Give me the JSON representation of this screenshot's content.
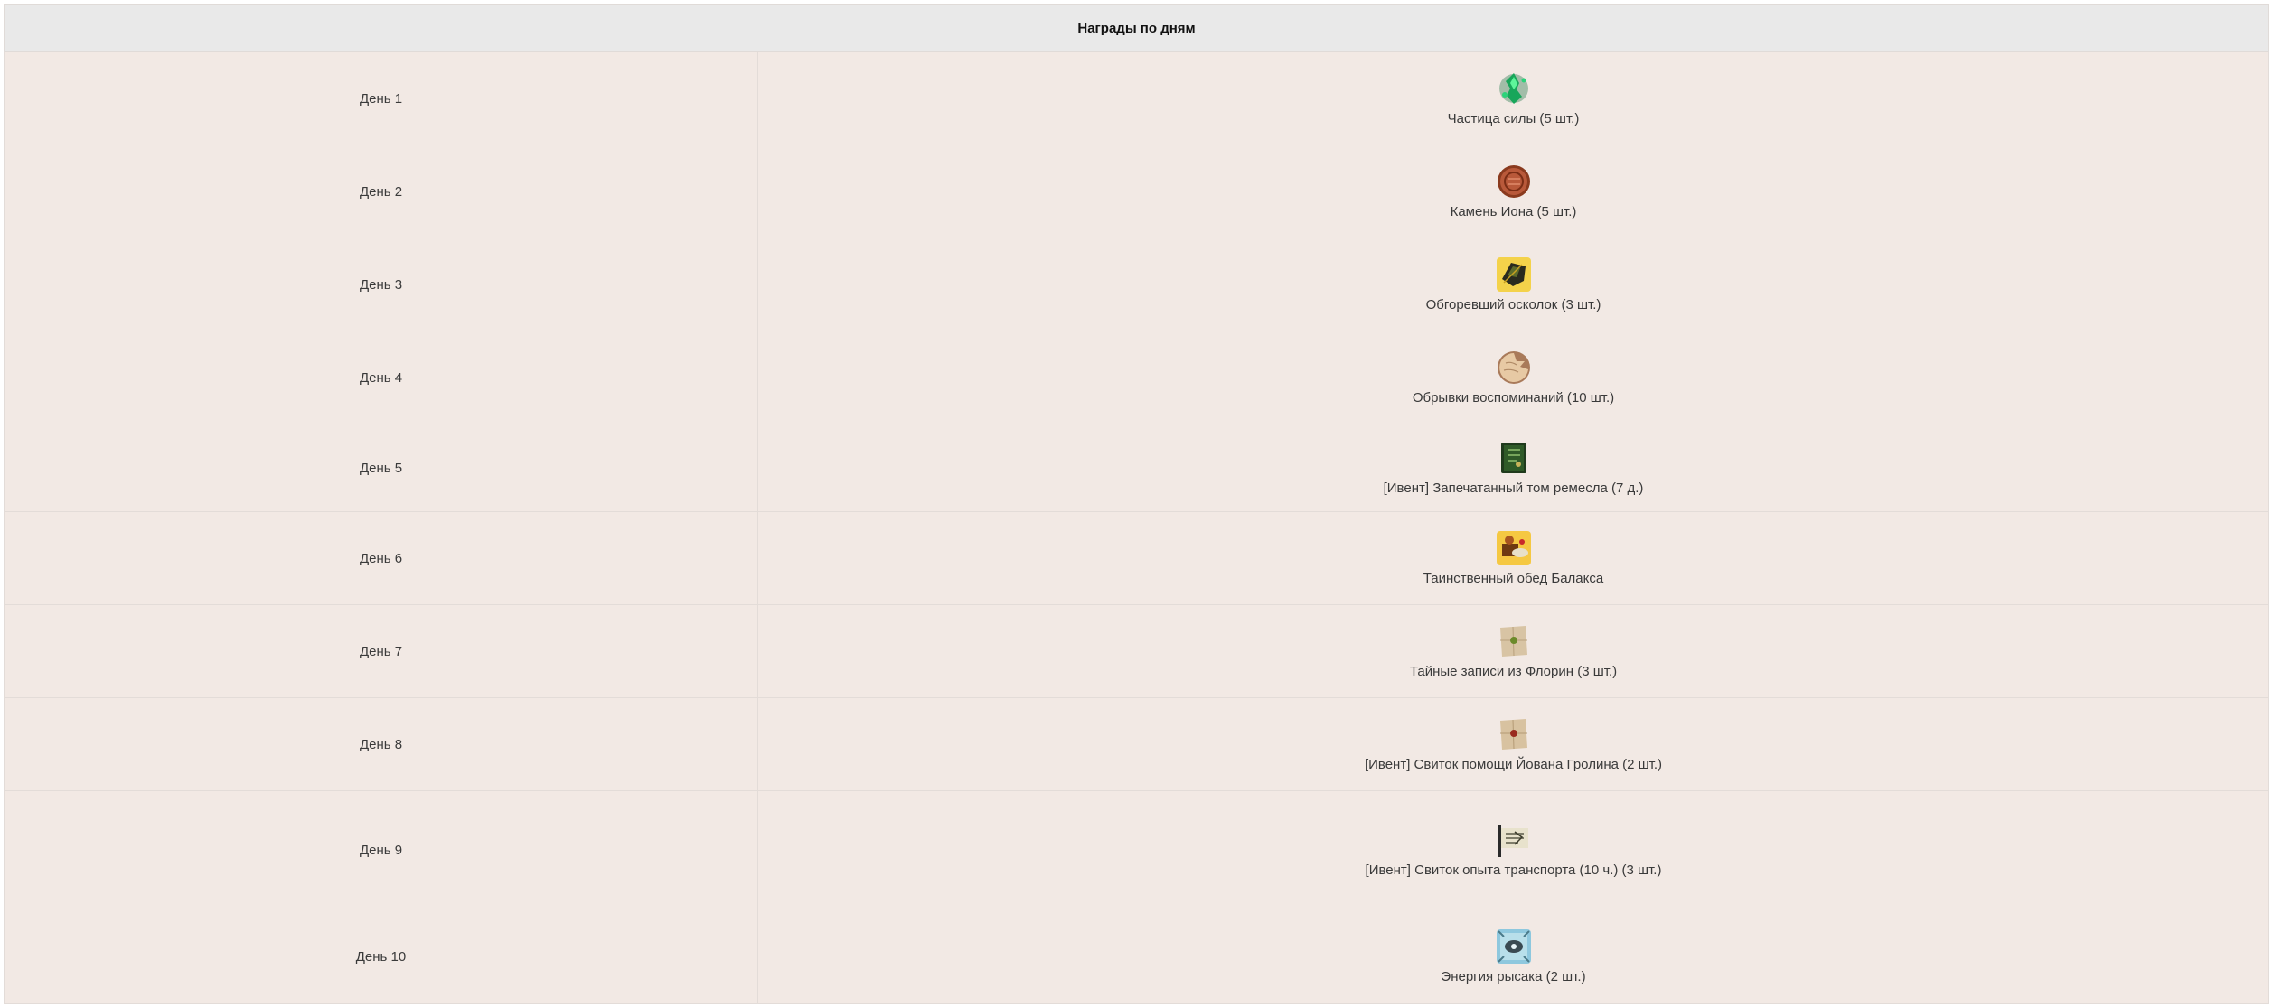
{
  "table": {
    "header": "Награды по дням",
    "rows": [
      {
        "day": "День 1",
        "reward": "Частица силы (5 шт.)",
        "icon": "green-crystal-icon"
      },
      {
        "day": "День 2",
        "reward": "Камень Иона (5 шт.)",
        "icon": "copper-coin-icon"
      },
      {
        "day": "День 3",
        "reward": "Обгоревший осколок (3 шт.)",
        "icon": "burnt-shard-icon"
      },
      {
        "day": "День 4",
        "reward": "Обрывки воспоминаний (10 шт.)",
        "icon": "torn-memory-icon"
      },
      {
        "day": "День 5",
        "reward": "[Ивент] Запечатанный том ремесла (7 д.)",
        "icon": "sealed-tome-icon"
      },
      {
        "day": "День 6",
        "reward": "Таинственный обед Балакса",
        "icon": "mystery-lunch-icon"
      },
      {
        "day": "День 7",
        "reward": "Тайные записи из Флорин (3 шт.)",
        "icon": "secret-notes-icon"
      },
      {
        "day": "День 8",
        "reward": "[Ивент] Свиток помощи Йована Гролина (2 шт.)",
        "icon": "help-scroll-icon"
      },
      {
        "day": "День 9",
        "reward": "[Ивент] Свиток опыта транспорта (10 ч.) (3 шт.)",
        "icon": "transport-scroll-icon"
      },
      {
        "day": "День 10",
        "reward": "Энергия рысака (2 шт.)",
        "icon": "steed-energy-icon"
      }
    ]
  }
}
